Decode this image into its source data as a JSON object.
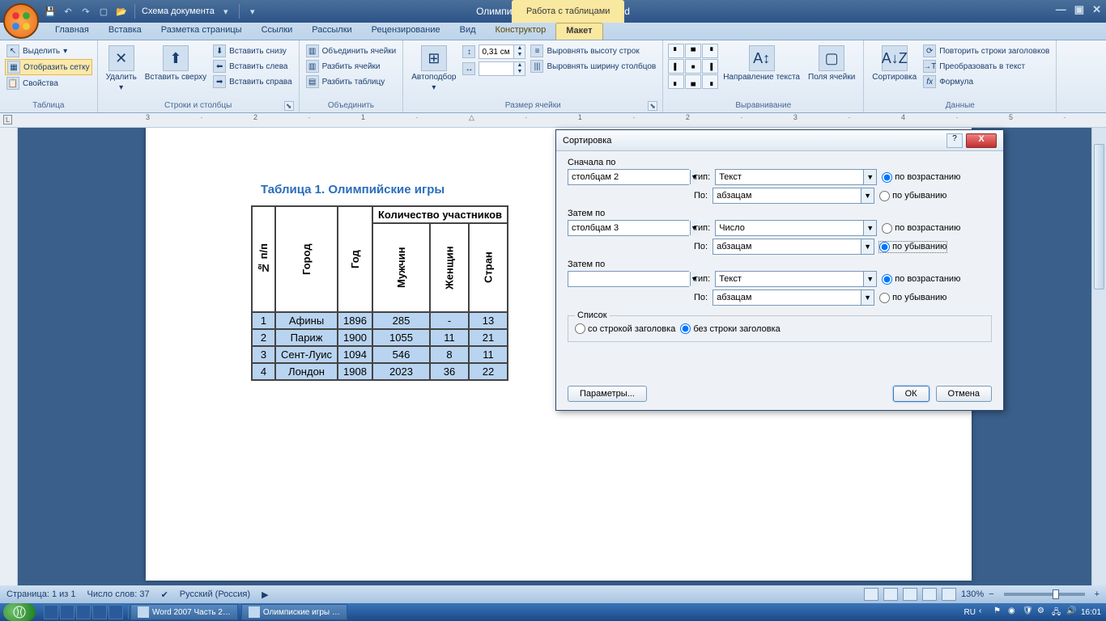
{
  "titlebar": {
    "qat_scheme": "Схема документа",
    "doc_title": "Олимпиские игры - Microsoft Word",
    "tools_title": "Работа с таблицами"
  },
  "tabs": {
    "home": "Главная",
    "insert": "Вставка",
    "layout": "Разметка страницы",
    "refs": "Ссылки",
    "mail": "Рассылки",
    "review": "Рецензирование",
    "view": "Вид",
    "design": "Конструктор",
    "tlayout": "Макет"
  },
  "ribbon": {
    "select": "Выделить",
    "showgrid": "Отобразить сетку",
    "props": "Свойства",
    "g_table": "Таблица",
    "delete": "Удалить",
    "ins_above": "Вставить сверху",
    "ins_below": "Вставить снизу",
    "ins_left": "Вставить слева",
    "ins_right": "Вставить справа",
    "g_rowscols": "Строки и столбцы",
    "merge": "Объединить ячейки",
    "split": "Разбить ячейки",
    "split_tbl": "Разбить таблицу",
    "g_merge": "Объединить",
    "autofit": "Автоподбор",
    "height": "0,31 см",
    "eq_rows": "Выровнять высоту строк",
    "eq_cols": "Выровнять ширину столбцов",
    "g_size": "Размер ячейки",
    "textdir": "Направление текста",
    "cellpad": "Поля ячейки",
    "g_align": "Выравнивание",
    "sort": "Сортировка",
    "repeat_hdr": "Повторить строки заголовков",
    "to_text": "Преобразовать в текст",
    "formula": "Формула",
    "g_data": "Данные"
  },
  "document": {
    "caption": "Таблица 1. Олимпийские игры",
    "col_super": "Количество участников",
    "h_num": "№ п/п",
    "h_city": "Город",
    "h_year": "Год",
    "h_men": "Мужчин",
    "h_women": "Женщин",
    "h_countries": "Стран",
    "rows": [
      {
        "n": "1",
        "city": "Афины",
        "year": "1896",
        "men": "285",
        "women": "-",
        "countries": "13"
      },
      {
        "n": "2",
        "city": "Париж",
        "year": "1900",
        "men": "1055",
        "women": "11",
        "countries": "21"
      },
      {
        "n": "3",
        "city": "Сент-Луис",
        "year": "1094",
        "men": "546",
        "women": "8",
        "countries": "11"
      },
      {
        "n": "4",
        "city": "Лондон",
        "year": "1908",
        "men": "2023",
        "women": "36",
        "countries": "22"
      }
    ]
  },
  "dialog": {
    "title": "Сортировка",
    "first_by": "Сначала по",
    "then_by": "Затем по",
    "type_lbl": "тип:",
    "by_lbl": "По:",
    "asc": "по возрастанию",
    "desc": "по убыванию",
    "list": "Список",
    "with_hdr": "со строкой заголовка",
    "no_hdr": "без строки заголовка",
    "params": "Параметры...",
    "ok": "ОК",
    "cancel": "Отмена",
    "s1_field": "столбцам 2",
    "s1_type": "Текст",
    "s1_using": "абзацам",
    "s2_field": "столбцам 3",
    "s2_type": "Число",
    "s2_using": "абзацам",
    "s3_field": "",
    "s3_type": "Текст",
    "s3_using": "абзацам"
  },
  "status": {
    "page": "Страница: 1 из 1",
    "words": "Число слов: 37",
    "lang": "Русский (Россия)",
    "zoom": "130%"
  },
  "taskbar": {
    "item1": "Word 2007 Часть 2…",
    "item2": "Олимпиские игры …",
    "lang": "RU",
    "time": "16:01"
  }
}
